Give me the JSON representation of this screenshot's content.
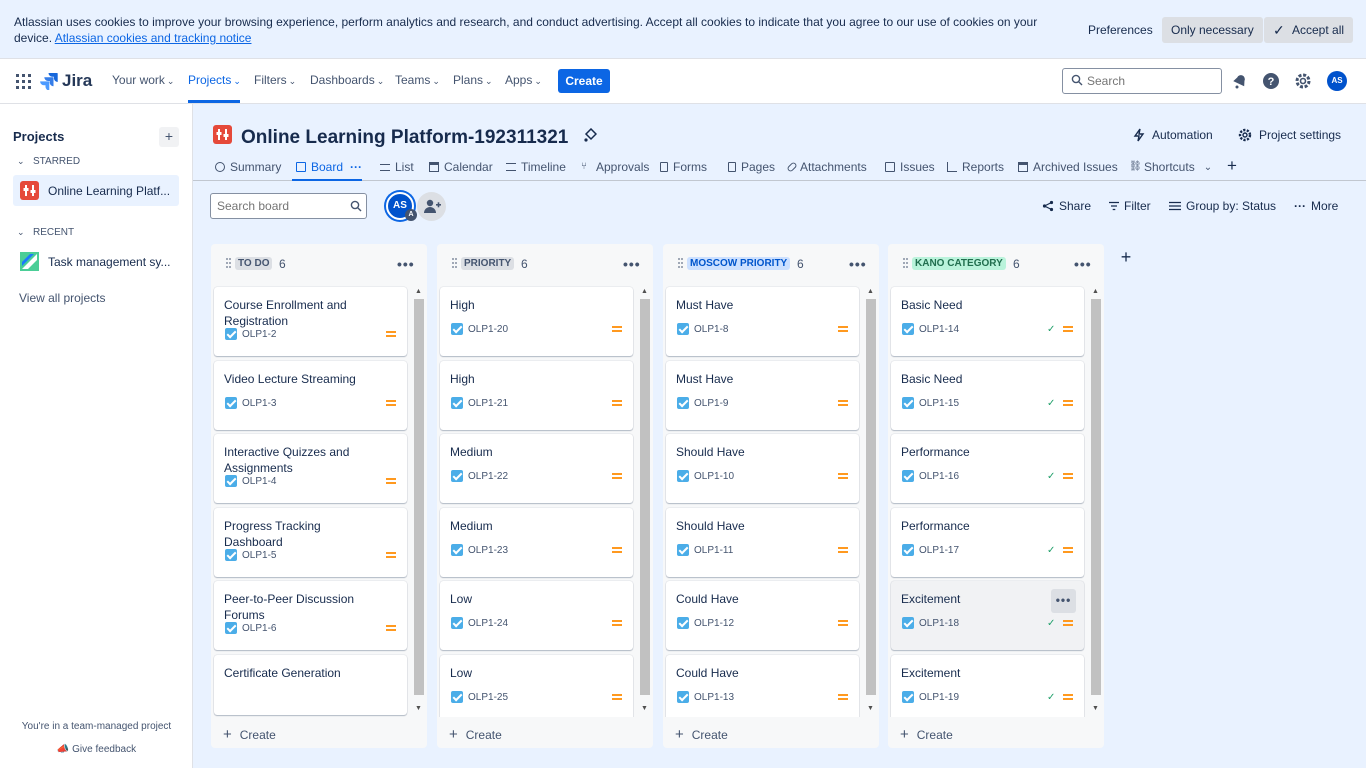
{
  "cookie": {
    "text": "Atlassian uses cookies to improve your browsing experience, perform analytics and research, and conduct advertising. Accept all cookies to indicate that you agree to our use of cookies on your device.",
    "link": "Atlassian cookies and tracking notice",
    "preferences": "Preferences",
    "only_necessary": "Only necessary",
    "accept_all": "Accept all"
  },
  "nav": {
    "logo": "Jira",
    "your_work": "Your work",
    "projects": "Projects",
    "filters": "Filters",
    "dashboards": "Dashboards",
    "teams": "Teams",
    "plans": "Plans",
    "apps": "Apps",
    "create": "Create",
    "search_placeholder": "Search",
    "avatar": "AS"
  },
  "sidebar": {
    "title": "Projects",
    "starred_label": "STARRED",
    "starred_item": "Online Learning Platf...",
    "recent_label": "RECENT",
    "recent_item": "Task management sy...",
    "view_all": "View all projects",
    "team_managed": "You're in a team-managed project",
    "feedback": "Give feedback"
  },
  "project": {
    "title": "Online Learning Platform-192311321",
    "automation": "Automation",
    "settings": "Project settings"
  },
  "tabs": [
    "Summary",
    "Board",
    "List",
    "Calendar",
    "Timeline",
    "Approvals",
    "Forms",
    "Pages",
    "Attachments",
    "Issues",
    "Reports",
    "Archived Issues",
    "Shortcuts"
  ],
  "toolbar": {
    "search_placeholder": "Search board",
    "avatar": "AS",
    "avatar_sub": "A",
    "share": "Share",
    "filter": "Filter",
    "group_by": "Group by: Status",
    "more": "More"
  },
  "columns": [
    {
      "title": "TO DO",
      "count": "6",
      "title_bg": "#dcdfe4",
      "title_color": "#44546f",
      "cards": [
        {
          "title": "Course Enrollment and Registration",
          "key": "OLP1-2"
        },
        {
          "title": "Video Lecture Streaming",
          "key": "OLP1-3"
        },
        {
          "title": "Interactive Quizzes and Assignments",
          "key": "OLP1-4"
        },
        {
          "title": "Progress Tracking Dashboard",
          "key": "OLP1-5"
        },
        {
          "title": "Peer-to-Peer Discussion Forums",
          "key": "OLP1-6"
        },
        {
          "title": "Certificate Generation",
          "key": ""
        }
      ]
    },
    {
      "title": "PRIORITY",
      "count": "6",
      "title_bg": "#dcdfe4",
      "title_color": "#44546f",
      "cards": [
        {
          "title": "High",
          "key": "OLP1-20"
        },
        {
          "title": "High",
          "key": "OLP1-21"
        },
        {
          "title": "Medium",
          "key": "OLP1-22"
        },
        {
          "title": "Medium",
          "key": "OLP1-23"
        },
        {
          "title": "Low",
          "key": "OLP1-24"
        },
        {
          "title": "Low",
          "key": "OLP1-25"
        }
      ]
    },
    {
      "title": "MOSCOW PRIORITY",
      "count": "6",
      "title_bg": "#cce0ff",
      "title_color": "#0055cc",
      "cards": [
        {
          "title": "Must Have",
          "key": "OLP1-8"
        },
        {
          "title": "Must Have",
          "key": "OLP1-9"
        },
        {
          "title": "Should Have",
          "key": "OLP1-10"
        },
        {
          "title": "Should Have",
          "key": "OLP1-11"
        },
        {
          "title": "Could Have",
          "key": "OLP1-12"
        },
        {
          "title": "Could Have",
          "key": "OLP1-13"
        }
      ]
    },
    {
      "title": "KANO CATEGORY",
      "count": "6",
      "title_bg": "#baf3db",
      "title_color": "#216e4e",
      "cards": [
        {
          "title": "Basic Need",
          "key": "OLP1-14",
          "done": true
        },
        {
          "title": "Basic Need",
          "key": "OLP1-15",
          "done": true
        },
        {
          "title": "Performance",
          "key": "OLP1-16",
          "done": true
        },
        {
          "title": "Performance",
          "key": "OLP1-17",
          "done": true
        },
        {
          "title": "Excitement",
          "key": "OLP1-18",
          "done": true,
          "hover": true
        },
        {
          "title": "Excitement",
          "key": "OLP1-19",
          "done": true
        }
      ]
    }
  ],
  "create_label": "Create",
  "colors": {
    "brand": "#0c66e4",
    "priority_medium": "#ff991f",
    "done": "#22a06b",
    "project_icon": "#e5493a"
  }
}
